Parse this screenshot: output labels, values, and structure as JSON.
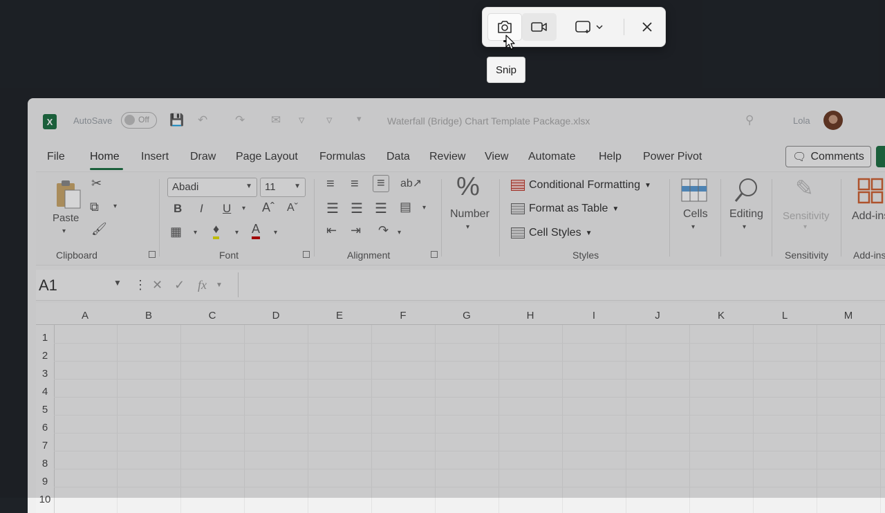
{
  "excel": {
    "logo_letter": "X",
    "autosave_label": "AutoSave",
    "autosave_state": "Off",
    "document_title": "Waterfall (Bridge) Chart Template Package.xlsx",
    "user_name": "Lola",
    "tabs": [
      {
        "label": "File"
      },
      {
        "label": "Home"
      },
      {
        "label": "Insert"
      },
      {
        "label": "Draw"
      },
      {
        "label": "Page Layout"
      },
      {
        "label": "Formulas"
      },
      {
        "label": "Data"
      },
      {
        "label": "Review"
      },
      {
        "label": "View"
      },
      {
        "label": "Automate"
      },
      {
        "label": "Help"
      },
      {
        "label": "Power Pivot"
      }
    ],
    "active_tab": "Home",
    "comments_label": "Comments",
    "ribbon": {
      "clipboard": {
        "paste_label": "Paste",
        "group_label": "Clipboard"
      },
      "font": {
        "font_name": "Abadi",
        "font_size": "11",
        "group_label": "Font"
      },
      "alignment": {
        "group_label": "Alignment"
      },
      "number": {
        "label": "Number",
        "symbol": "%"
      },
      "styles": {
        "conditional_formatting": "Conditional Formatting",
        "format_as_table": "Format as Table",
        "cell_styles": "Cell Styles",
        "group_label": "Styles"
      },
      "cells_label": "Cells",
      "editing_label": "Editing",
      "sensitivity": {
        "button_label": "Sensitivity",
        "group_label": "Sensitivity"
      },
      "addins": {
        "button_label": "Add-ins",
        "group_label": "Add-ins"
      }
    },
    "formula_bar": {
      "name_box": "A1",
      "fx_symbol": "fx"
    },
    "columns": [
      "A",
      "B",
      "C",
      "D",
      "E",
      "F",
      "G",
      "H",
      "I",
      "J",
      "K",
      "L",
      "M"
    ],
    "rows": [
      "1",
      "2",
      "3",
      "4",
      "5",
      "6",
      "7",
      "8",
      "9",
      "10"
    ]
  },
  "snip_toolbar": {
    "tooltip": "Snip",
    "selected_mode": "screenshot"
  }
}
